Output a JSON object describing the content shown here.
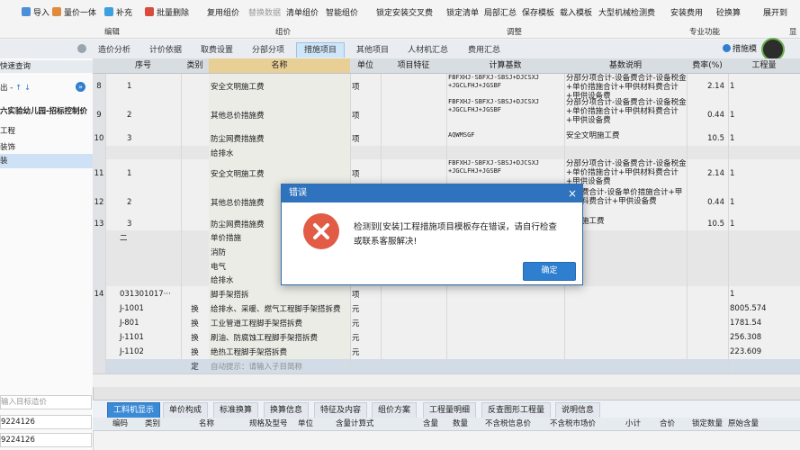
{
  "toolbar": {
    "buttons": [
      "导入",
      "量价一体",
      "补充",
      "批量删除",
      "复用组价",
      "替换数据",
      "清单组价",
      "智能组价",
      "锁定安装交叉费",
      "锁定清单",
      "局部汇总",
      "保存模板",
      "载入模板",
      "大型机械检测费",
      "安装费用",
      "砼换算",
      "展开到"
    ],
    "groups": [
      "编辑",
      "组价",
      "调整",
      "专业功能",
      "显"
    ]
  },
  "tabs": [
    "造价分析",
    "计价依据",
    "取费设置",
    "分部分项",
    "措施项目",
    "其他项目",
    "人材机汇总",
    "费用汇总"
  ],
  "active_tab": "措施项目",
  "tab_right_label": "措施模",
  "left_panel": {
    "title": "快速查询",
    "toolbar": "出 -",
    "project": "六实验幼儿园-招标控制价",
    "items": [
      "工程",
      "装饰",
      "装"
    ],
    "search_placeholder": "输入目标造价",
    "values": [
      "9224126",
      "9224126"
    ]
  },
  "grid": {
    "headers": [
      "序号",
      "类别",
      "名称",
      "单位",
      "项目特征",
      "计算基数",
      "基数说明",
      "费率(%)",
      "工程量"
    ],
    "rows": [
      {
        "num": "8",
        "seq": "1",
        "type": "",
        "name": "安全文明施工费",
        "unit": "项",
        "base": "FBFXHJ-SBFXJ-SBSJ+DJCSXJ\n+JGCLFHJ+JGSBF",
        "desc": "分部分项合计-设备费合计-设备税金+单价措施合计+甲供材料费合计+甲供设备费",
        "rate": "2.14",
        "qty": "1"
      },
      {
        "num": "9",
        "seq": "2",
        "type": "",
        "name": "其他总价措施费",
        "unit": "项",
        "base": "FBFXHJ-SBFXJ-SBSJ+DJCSXJ\n+JGCLFHJ+JGSBF",
        "desc": "分部分项合计-设备费合计-设备税金+单价措施合计+甲供材料费合计+甲供设备费",
        "rate": "0.44",
        "qty": "1"
      },
      {
        "num": "10",
        "seq": "3",
        "type": "",
        "name": "防尘网费措施费",
        "unit": "项",
        "base": "AQWMSGF",
        "desc": "安全文明施工费",
        "rate": "10.5",
        "qty": "1"
      },
      {
        "num": "",
        "seq": "",
        "type": "",
        "name": "给排水",
        "unit": "",
        "base": "",
        "desc": "",
        "rate": "",
        "qty": ""
      },
      {
        "num": "11",
        "seq": "1",
        "type": "",
        "name": "安全文明施工费",
        "unit": "项",
        "base": "FBFXHJ-SBFXJ-SBSJ+DJCSXJ\n+JGCLFHJ+JGSBF",
        "desc": "分部分项合计-设备费合计-设备税金+单价措施合计+甲供材料费合计+甲供设备费",
        "rate": "2.14",
        "qty": "1"
      },
      {
        "num": "12",
        "seq": "2",
        "type": "",
        "name": "其他总价措施费",
        "unit": "项",
        "base": "",
        "desc": "设备费合计-设备单价措施合计+甲供材料费合计+甲供设备费",
        "rate": "0.44",
        "qty": "1"
      },
      {
        "num": "13",
        "seq": "3",
        "type": "",
        "name": "防尘网费措施费",
        "unit": "项",
        "base": "",
        "desc": "文明施工费",
        "rate": "10.5",
        "qty": "1"
      },
      {
        "num": "",
        "seq": "二",
        "type": "",
        "name": "单价措施",
        "unit": "",
        "base": "",
        "desc": "",
        "rate": "",
        "qty": ""
      },
      {
        "num": "",
        "seq": "",
        "type": "",
        "name": "消防",
        "unit": "",
        "base": "",
        "desc": "",
        "rate": "",
        "qty": ""
      },
      {
        "num": "",
        "seq": "",
        "type": "",
        "name": "电气",
        "unit": "",
        "base": "",
        "desc": "",
        "rate": "",
        "qty": ""
      },
      {
        "num": "",
        "seq": "",
        "type": "",
        "name": "给排水",
        "unit": "",
        "base": "",
        "desc": "",
        "rate": "",
        "qty": ""
      },
      {
        "num": "14",
        "seq": "031301017···",
        "type": "",
        "name": "脚手架搭拆",
        "unit": "项",
        "base": "",
        "desc": "",
        "rate": "",
        "qty": "1"
      },
      {
        "num": "",
        "seq": "J-1001",
        "type": "换",
        "name": "给排水、采暖、燃气工程脚手架搭拆费",
        "unit": "元",
        "base": "",
        "desc": "",
        "rate": "",
        "qty": "8005.574"
      },
      {
        "num": "",
        "seq": "J-801",
        "type": "换",
        "name": "工业管道工程脚手架搭拆费",
        "unit": "元",
        "base": "",
        "desc": "",
        "rate": "",
        "qty": "1781.54"
      },
      {
        "num": "",
        "seq": "J-1101",
        "type": "换",
        "name": "刷油、防腐蚀工程脚手架搭拆费",
        "unit": "元",
        "base": "",
        "desc": "",
        "rate": "",
        "qty": "256.308"
      },
      {
        "num": "",
        "seq": "J-1102",
        "type": "换",
        "name": "绝热工程脚手架搭拆费",
        "unit": "元",
        "base": "",
        "desc": "",
        "rate": "",
        "qty": "223.609"
      },
      {
        "num": "",
        "seq": "",
        "type": "定",
        "name": "自动提示：请输入子目简称",
        "unit": "",
        "base": "",
        "desc": "",
        "rate": "",
        "qty": ""
      }
    ]
  },
  "dialog": {
    "title": "错误",
    "message": "检测到[安装]工程措施项目模板存在错误，请自行检查或联系客服解决!",
    "ok_label": "确定",
    "close_glyph": "×",
    "error_color": "#e25b44"
  },
  "bottom_tabs": [
    "工料机显示",
    "单价构成",
    "标准换算",
    "换算信息",
    "特征及内容",
    "组价方案",
    "工程量明细",
    "反查图形工程量",
    "说明信息"
  ],
  "bottom_active": "工料机显示",
  "bottom_headers": [
    "编码",
    "类别",
    "名称",
    "规格及型号",
    "单位",
    "含量计算式",
    "含量",
    "数量",
    "不含税信息价",
    "不含税市场价",
    "小计",
    "合价",
    "锁定数量",
    "原始含量"
  ],
  "colors": {
    "accent": "#2f72bd",
    "header_bg": "#e6ebf0",
    "tab_active": "#cfe6f8"
  }
}
